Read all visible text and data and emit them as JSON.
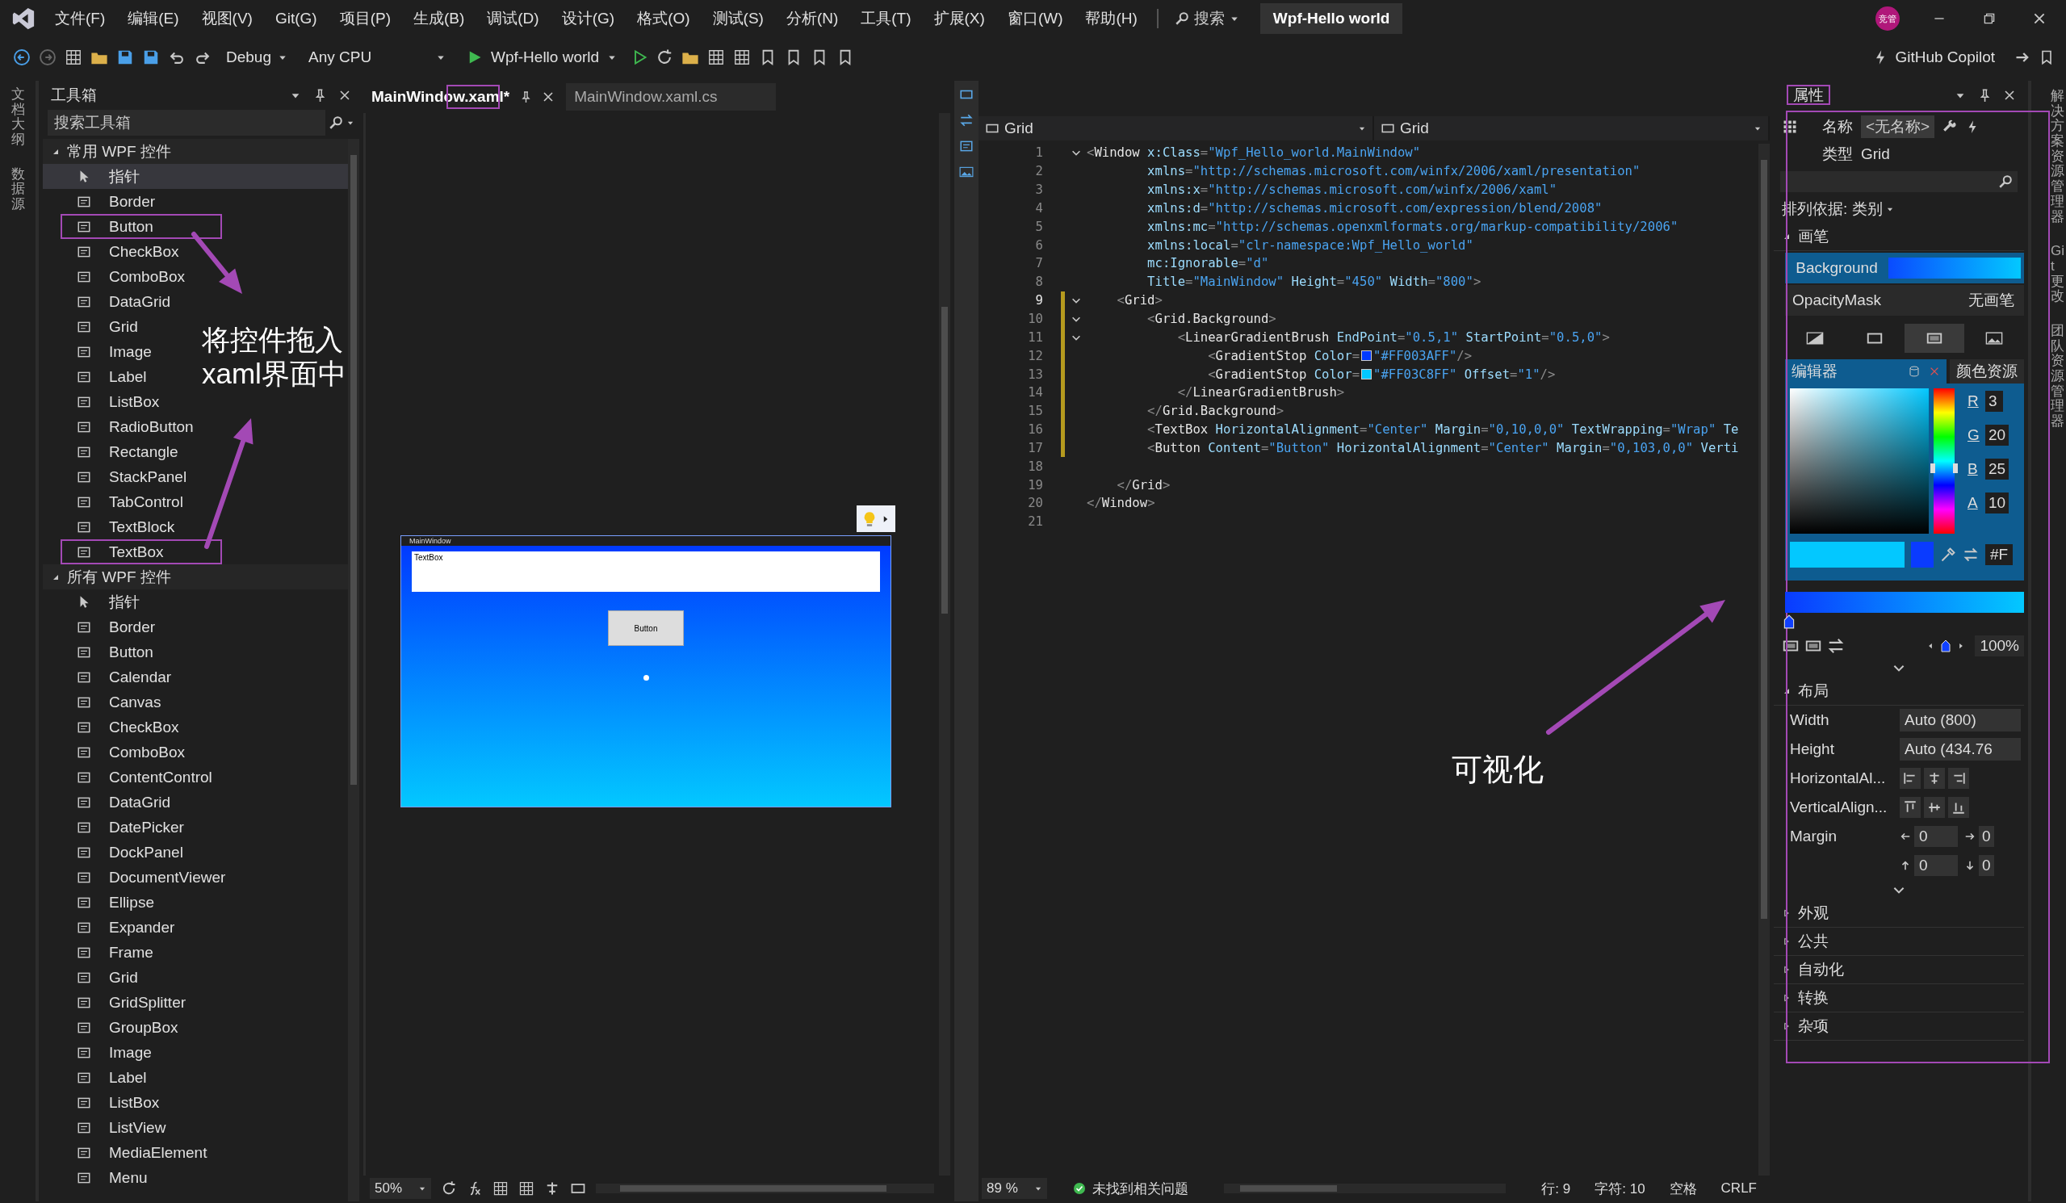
{
  "menu": {
    "items": [
      "文件(F)",
      "编辑(E)",
      "视图(V)",
      "Git(G)",
      "项目(P)",
      "生成(B)",
      "调试(D)",
      "设计(G)",
      "格式(O)",
      "测试(S)",
      "分析(N)",
      "工具(T)",
      "扩展(X)",
      "窗口(W)",
      "帮助(H)"
    ],
    "search": "搜索",
    "title": "Wpf-Hello world",
    "avatar": "竞管"
  },
  "toolbar": {
    "configuration": "Debug",
    "platform": "Any CPU",
    "run_target": "Wpf-Hello world",
    "copilot": "GitHub Copilot"
  },
  "left_strip": [
    "文档大纲",
    "数据源"
  ],
  "toolbox": {
    "title": "工具箱",
    "placeholder": "搜索工具箱",
    "groups": [
      {
        "title": "常用 WPF 控件",
        "expanded": true,
        "items": [
          {
            "label": "指针",
            "selected": true,
            "outlined": false
          },
          {
            "label": "Border",
            "selected": false,
            "outlined": false
          },
          {
            "label": "Button",
            "selected": false,
            "outlined": true
          },
          {
            "label": "CheckBox",
            "selected": false,
            "outlined": false
          },
          {
            "label": "ComboBox",
            "selected": false,
            "outlined": false
          },
          {
            "label": "DataGrid",
            "selected": false,
            "outlined": false
          },
          {
            "label": "Grid",
            "selected": false,
            "outlined": false
          },
          {
            "label": "Image",
            "selected": false,
            "outlined": false
          },
          {
            "label": "Label",
            "selected": false,
            "outlined": false
          },
          {
            "label": "ListBox",
            "selected": false,
            "outlined": false
          },
          {
            "label": "RadioButton",
            "selected": false,
            "outlined": false
          },
          {
            "label": "Rectangle",
            "selected": false,
            "outlined": false
          },
          {
            "label": "StackPanel",
            "selected": false,
            "outlined": false
          },
          {
            "label": "TabControl",
            "selected": false,
            "outlined": false
          },
          {
            "label": "TextBlock",
            "selected": false,
            "outlined": false
          },
          {
            "label": "TextBox",
            "selected": false,
            "outlined": true
          }
        ]
      },
      {
        "title": "所有 WPF 控件",
        "expanded": true,
        "items": [
          {
            "label": "指针",
            "selected": false,
            "outlined": false
          },
          {
            "label": "Border",
            "selected": false,
            "outlined": false
          },
          {
            "label": "Button",
            "selected": false,
            "outlined": false
          },
          {
            "label": "Calendar",
            "selected": false,
            "outlined": false
          },
          {
            "label": "Canvas",
            "selected": false,
            "outlined": false
          },
          {
            "label": "CheckBox",
            "selected": false,
            "outlined": false
          },
          {
            "label": "ComboBox",
            "selected": false,
            "outlined": false
          },
          {
            "label": "ContentControl",
            "selected": false,
            "outlined": false
          },
          {
            "label": "DataGrid",
            "selected": false,
            "outlined": false
          },
          {
            "label": "DatePicker",
            "selected": false,
            "outlined": false
          },
          {
            "label": "DockPanel",
            "selected": false,
            "outlined": false
          },
          {
            "label": "DocumentViewer",
            "selected": false,
            "outlined": false
          },
          {
            "label": "Ellipse",
            "selected": false,
            "outlined": false
          },
          {
            "label": "Expander",
            "selected": false,
            "outlined": false
          },
          {
            "label": "Frame",
            "selected": false,
            "outlined": false
          },
          {
            "label": "Grid",
            "selected": false,
            "outlined": false
          },
          {
            "label": "GridSplitter",
            "selected": false,
            "outlined": false
          },
          {
            "label": "GroupBox",
            "selected": false,
            "outlined": false
          },
          {
            "label": "Image",
            "selected": false,
            "outlined": false
          },
          {
            "label": "Label",
            "selected": false,
            "outlined": false
          },
          {
            "label": "ListBox",
            "selected": false,
            "outlined": false
          },
          {
            "label": "ListView",
            "selected": false,
            "outlined": false
          },
          {
            "label": "MediaElement",
            "selected": false,
            "outlined": false
          },
          {
            "label": "Menu",
            "selected": false,
            "outlined": false
          }
        ]
      }
    ]
  },
  "designer": {
    "tabs": [
      {
        "label": "MainWindow.xaml*",
        "selected": true,
        "outlined": true
      },
      {
        "label": "MainWindow.xaml.cs",
        "selected": false,
        "outlined": false
      }
    ],
    "preview": {
      "title": "MainWindow",
      "textbox": "TextBox",
      "button": "Button"
    },
    "zoom": "50%"
  },
  "editor": {
    "scopes": [
      "Grid",
      "Grid"
    ],
    "lines": [
      {
        "number": "1",
        "current": false,
        "fold": true,
        "changed": false,
        "tokens": [
          {
            "kind": "punct",
            "text": "<"
          },
          {
            "kind": "tag",
            "text": "Window"
          },
          {
            "kind": "attr",
            "text": " x:Class"
          },
          {
            "kind": "punct",
            "text": "="
          },
          {
            "kind": "value",
            "text": "\"Wpf_Hello_world.MainWindow\""
          }
        ]
      },
      {
        "number": "2",
        "current": false,
        "fold": false,
        "changed": false,
        "tokens": [
          {
            "kind": "attr",
            "text": "        xmlns"
          },
          {
            "kind": "punct",
            "text": "="
          },
          {
            "kind": "value",
            "text": "\"http://schemas.microsoft.com/winfx/2006/xaml/presentation\""
          }
        ]
      },
      {
        "number": "3",
        "current": false,
        "fold": false,
        "changed": false,
        "tokens": [
          {
            "kind": "attr",
            "text": "        xmlns:x"
          },
          {
            "kind": "punct",
            "text": "="
          },
          {
            "kind": "value",
            "text": "\"http://schemas.microsoft.com/winfx/2006/xaml\""
          }
        ]
      },
      {
        "number": "4",
        "current": false,
        "fold": false,
        "changed": false,
        "tokens": [
          {
            "kind": "attr",
            "text": "        xmlns:d"
          },
          {
            "kind": "punct",
            "text": "="
          },
          {
            "kind": "value",
            "text": "\"http://schemas.microsoft.com/expression/blend/2008\""
          }
        ]
      },
      {
        "number": "5",
        "current": false,
        "fold": false,
        "changed": false,
        "tokens": [
          {
            "kind": "attr",
            "text": "        xmlns:mc"
          },
          {
            "kind": "punct",
            "text": "="
          },
          {
            "kind": "value",
            "text": "\"http://schemas.openxmlformats.org/markup-compatibility/2006\""
          }
        ]
      },
      {
        "number": "6",
        "current": false,
        "fold": false,
        "changed": false,
        "tokens": [
          {
            "kind": "attr",
            "text": "        xmlns:local"
          },
          {
            "kind": "punct",
            "text": "="
          },
          {
            "kind": "value",
            "text": "\"clr-namespace:Wpf_Hello_world\""
          }
        ]
      },
      {
        "number": "7",
        "current": false,
        "fold": false,
        "changed": false,
        "tokens": [
          {
            "kind": "attr",
            "text": "        mc:Ignorable"
          },
          {
            "kind": "punct",
            "text": "="
          },
          {
            "kind": "value",
            "text": "\"d\""
          }
        ]
      },
      {
        "number": "8",
        "current": false,
        "fold": false,
        "changed": false,
        "tokens": [
          {
            "kind": "attr",
            "text": "        Title"
          },
          {
            "kind": "punct",
            "text": "="
          },
          {
            "kind": "value",
            "text": "\"MainWindow\""
          },
          {
            "kind": "attr",
            "text": " Height"
          },
          {
            "kind": "punct",
            "text": "="
          },
          {
            "kind": "value",
            "text": "\"450\""
          },
          {
            "kind": "attr",
            "text": " Width"
          },
          {
            "kind": "punct",
            "text": "="
          },
          {
            "kind": "value",
            "text": "\"800\""
          },
          {
            "kind": "punct",
            "text": ">"
          }
        ]
      },
      {
        "number": "9",
        "current": true,
        "fold": true,
        "changed": true,
        "tokens": [
          {
            "kind": "punct",
            "text": "    <"
          },
          {
            "kind": "tag",
            "text": "Grid"
          },
          {
            "kind": "punct",
            "text": ">"
          }
        ]
      },
      {
        "number": "10",
        "current": false,
        "fold": true,
        "changed": true,
        "tokens": [
          {
            "kind": "punct",
            "text": "        <"
          },
          {
            "kind": "tag",
            "text": "Grid.Background"
          },
          {
            "kind": "punct",
            "text": ">"
          }
        ]
      },
      {
        "number": "11",
        "current": false,
        "fold": true,
        "changed": true,
        "tokens": [
          {
            "kind": "punct",
            "text": "            <"
          },
          {
            "kind": "tag",
            "text": "LinearGradientBrush"
          },
          {
            "kind": "attr",
            "text": " EndPoint"
          },
          {
            "kind": "punct",
            "text": "="
          },
          {
            "kind": "value",
            "text": "\"0.5,1\""
          },
          {
            "kind": "attr",
            "text": " StartPoint"
          },
          {
            "kind": "punct",
            "text": "="
          },
          {
            "kind": "value",
            "text": "\"0.5,0\""
          },
          {
            "kind": "punct",
            "text": ">"
          }
        ]
      },
      {
        "number": "12",
        "current": false,
        "fold": false,
        "changed": true,
        "tokens": [
          {
            "kind": "punct",
            "text": "                <"
          },
          {
            "kind": "tag",
            "text": "GradientStop"
          },
          {
            "kind": "attr",
            "text": " Color"
          },
          {
            "kind": "punct",
            "text": "="
          },
          {
            "kind": "swatch",
            "color": "#003aff"
          },
          {
            "kind": "value",
            "text": "\"#FF003AFF\""
          },
          {
            "kind": "punct",
            "text": "/>"
          }
        ]
      },
      {
        "number": "13",
        "current": false,
        "fold": false,
        "changed": true,
        "tokens": [
          {
            "kind": "punct",
            "text": "                <"
          },
          {
            "kind": "tag",
            "text": "GradientStop"
          },
          {
            "kind": "attr",
            "text": " Color"
          },
          {
            "kind": "punct",
            "text": "="
          },
          {
            "kind": "swatch",
            "color": "#03c8ff"
          },
          {
            "kind": "value",
            "text": "\"#FF03C8FF\""
          },
          {
            "kind": "attr",
            "text": " Offset"
          },
          {
            "kind": "punct",
            "text": "="
          },
          {
            "kind": "value",
            "text": "\"1\""
          },
          {
            "kind": "punct",
            "text": "/>"
          }
        ]
      },
      {
        "number": "14",
        "current": false,
        "fold": false,
        "changed": true,
        "tokens": [
          {
            "kind": "punct",
            "text": "            </"
          },
          {
            "kind": "tag",
            "text": "LinearGradientBrush"
          },
          {
            "kind": "punct",
            "text": ">"
          }
        ]
      },
      {
        "number": "15",
        "current": false,
        "fold": false,
        "changed": true,
        "tokens": [
          {
            "kind": "punct",
            "text": "        </"
          },
          {
            "kind": "tag",
            "text": "Grid.Background"
          },
          {
            "kind": "punct",
            "text": ">"
          }
        ]
      },
      {
        "number": "16",
        "current": false,
        "fold": false,
        "changed": true,
        "tokens": [
          {
            "kind": "punct",
            "text": "        <"
          },
          {
            "kind": "tag",
            "text": "TextBox"
          },
          {
            "kind": "attr",
            "text": " HorizontalAlignment"
          },
          {
            "kind": "punct",
            "text": "="
          },
          {
            "kind": "value",
            "text": "\"Center\""
          },
          {
            "kind": "attr",
            "text": " Margin"
          },
          {
            "kind": "punct",
            "text": "="
          },
          {
            "kind": "value",
            "text": "\"0,10,0,0\""
          },
          {
            "kind": "attr",
            "text": " TextWrapping"
          },
          {
            "kind": "punct",
            "text": "="
          },
          {
            "kind": "value",
            "text": "\"Wrap\""
          },
          {
            "kind": "attr",
            "text": " Te"
          }
        ]
      },
      {
        "number": "17",
        "current": false,
        "fold": false,
        "changed": true,
        "tokens": [
          {
            "kind": "punct",
            "text": "        <"
          },
          {
            "kind": "tag",
            "text": "Button"
          },
          {
            "kind": "attr",
            "text": " Content"
          },
          {
            "kind": "punct",
            "text": "="
          },
          {
            "kind": "value",
            "text": "\"Button\""
          },
          {
            "kind": "attr",
            "text": " HorizontalAlignment"
          },
          {
            "kind": "punct",
            "text": "="
          },
          {
            "kind": "value",
            "text": "\"Center\""
          },
          {
            "kind": "attr",
            "text": " Margin"
          },
          {
            "kind": "punct",
            "text": "="
          },
          {
            "kind": "value",
            "text": "\"0,103,0,0\""
          },
          {
            "kind": "attr",
            "text": " Verti"
          }
        ]
      },
      {
        "number": "18",
        "current": false,
        "fold": false,
        "changed": false
      },
      {
        "number": "19",
        "current": false,
        "fold": false,
        "changed": false,
        "tokens": [
          {
            "kind": "punct",
            "text": "    </"
          },
          {
            "kind": "tag",
            "text": "Grid"
          },
          {
            "kind": "punct",
            "text": ">"
          }
        ]
      },
      {
        "number": "20",
        "current": false,
        "fold": false,
        "changed": false,
        "tokens": [
          {
            "kind": "punct",
            "text": "</"
          },
          {
            "kind": "tag",
            "text": "Window"
          },
          {
            "kind": "punct",
            "text": ">"
          }
        ]
      },
      {
        "number": "21",
        "current": false,
        "fold": false,
        "changed": false
      }
    ],
    "zoom": "89 %",
    "issues": "未找到相关问题",
    "position": [
      "行: 9",
      "字符: 10",
      "空格",
      "CRLF"
    ]
  },
  "properties": {
    "title": "属性",
    "outlined": true,
    "name_label": "名称",
    "name_value": "<无名称>",
    "type_label": "类型",
    "type_value": "Grid",
    "sort": "排列依据: 类别",
    "brush": {
      "title": "画笔",
      "expanded": true,
      "rows": [
        {
          "label": "Background",
          "selected": true,
          "kind": "gradient"
        },
        {
          "label": "OpacityMask",
          "selected": false,
          "kind": "text",
          "value": "无画笔"
        }
      ],
      "types": [
        {
          "selected": false
        },
        {
          "selected": false
        },
        {
          "selected": true
        },
        {
          "selected": false
        }
      ],
      "tabs": [
        {
          "label": "编辑器",
          "selected": true
        },
        {
          "label": "颜色资源",
          "selected": false
        }
      ],
      "hue_slider": {
        "level": 0.45
      },
      "channels": [
        {
          "label": "R",
          "value": "3"
        },
        {
          "label": "G",
          "value": "20"
        },
        {
          "label": "B",
          "value": "25"
        },
        {
          "label": "A",
          "value": "10"
        }
      ],
      "hex": "#F",
      "opacity": "100%"
    },
    "layout": {
      "title": "布局",
      "expanded": true,
      "rows": [
        {
          "label": "Width",
          "kind": "field",
          "value": "Auto (800)"
        },
        {
          "label": "Height",
          "kind": "field",
          "value": "Auto (434.76"
        },
        {
          "label": "HorizontalAl...",
          "kind": "halign"
        },
        {
          "label": "VerticalAlign...",
          "kind": "valign"
        }
      ],
      "margin_label": "Margin",
      "margins": [
        "0",
        "0",
        "0",
        "0"
      ]
    },
    "sections": [
      {
        "title": "外观",
        "expanded": false
      },
      {
        "title": "公共",
        "expanded": false
      },
      {
        "title": "自动化",
        "expanded": false
      },
      {
        "title": "转换",
        "expanded": false
      },
      {
        "title": "杂项",
        "expanded": false
      }
    ]
  },
  "right_strip": [
    "解决方案资源管理器",
    "Git 更改",
    "团队资源管理器"
  ],
  "annotations": [
    {
      "kind": "text",
      "lines": [
        "将控件拖入",
        "xaml界面中"
      ]
    },
    {
      "kind": "text",
      "lines": [
        "可视化"
      ]
    }
  ]
}
